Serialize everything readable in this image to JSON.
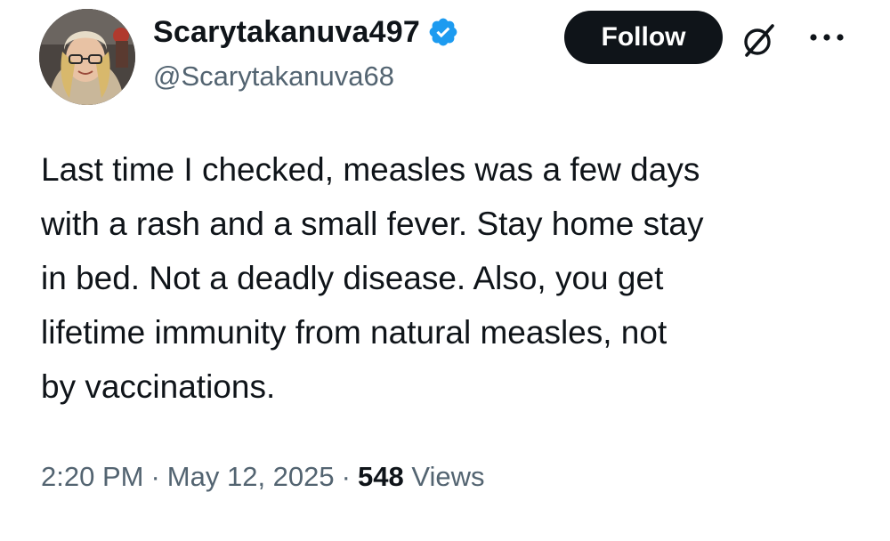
{
  "author": {
    "display_name": "Scarytakanuva497",
    "handle": "@Scarytakanuva68",
    "verified": true,
    "avatar": "profile-photo"
  },
  "actions": {
    "follow_label": "Follow",
    "grok_icon": "slashed-circle-icon",
    "more_icon": "ellipsis-icon"
  },
  "tweet": {
    "text": "Last time I checked, measles was a few days\nwith a rash and a small fever. Stay home stay\nin bed. Not a deadly disease. Also, you get\nlifetime immunity from natural measles, not\nby vaccinations."
  },
  "meta": {
    "time": "2:20 PM",
    "separator": "·",
    "date": "May 12, 2025",
    "views_count": "548",
    "views_label": "Views"
  },
  "colors": {
    "text": "#0f1419",
    "secondary_text": "#536471",
    "verified_badge": "#1d9bf0",
    "follow_button": "#0f1419"
  }
}
